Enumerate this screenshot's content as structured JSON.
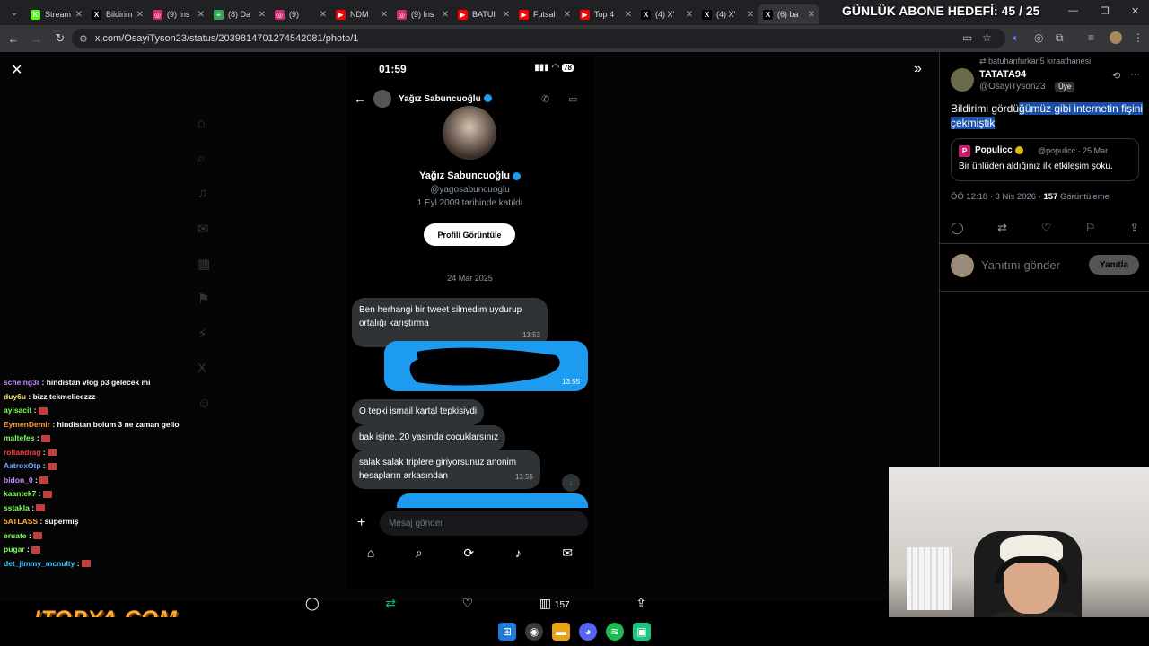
{
  "overlay_title": "GÜNLÜK ABONE HEDEFİ: 45 / 25",
  "browser": {
    "tabs": [
      {
        "label": "Stream",
        "icon": "kick-icon",
        "color": "#53fc18",
        "glyph": "K"
      },
      {
        "label": "Bildirim",
        "icon": "x-icon",
        "color": "#000000",
        "glyph": "X"
      },
      {
        "label": "(9) Ins",
        "icon": "instagram-icon",
        "color": "#d62976",
        "glyph": "◎"
      },
      {
        "label": "(8) Da",
        "icon": "chat-icon",
        "color": "#34a853",
        "glyph": "≡"
      },
      {
        "label": "(9)",
        "icon": "instagram-icon",
        "color": "#d62976",
        "glyph": "◎"
      },
      {
        "label": "NDM",
        "icon": "youtube-icon",
        "color": "#ff0000",
        "glyph": "▶"
      },
      {
        "label": "(9) Ins",
        "icon": "instagram-icon",
        "color": "#d62976",
        "glyph": "◎"
      },
      {
        "label": "BATUI",
        "icon": "youtube-icon",
        "color": "#ff0000",
        "glyph": "▶"
      },
      {
        "label": "Futsal",
        "icon": "youtube-icon",
        "color": "#ff0000",
        "glyph": "▶"
      },
      {
        "label": "Top 4",
        "icon": "youtube-icon",
        "color": "#ff0000",
        "glyph": "▶"
      },
      {
        "label": "(4) X'",
        "icon": "x-icon",
        "color": "#000000",
        "glyph": "X"
      },
      {
        "label": "(4) X'",
        "icon": "x-icon",
        "color": "#000000",
        "glyph": "X"
      },
      {
        "label": "(6) ba",
        "icon": "x-icon",
        "color": "#000000",
        "glyph": "X",
        "active": true
      }
    ],
    "url": "x.com/OsayiTyson23/status/2039814701274542081/photo/1"
  },
  "phone": {
    "time": "01:59",
    "battery": "78",
    "contact_name": "Yağız Sabuncuoğlu",
    "profile_name": "Yağız Sabuncuoğlu",
    "profile_handle": "@yagosabuncuoglu",
    "profile_joined": "1 Eyl 2009 tarihinde katıldı",
    "profile_button": "Profili Görüntüle",
    "date_separator": "24 Mar 2025",
    "messages": [
      {
        "text": "Ben herhangi bir tweet silmedim uydurup ortalığı karıştırma",
        "time": "13:53"
      },
      {
        "text": "O tepki ismail kartal tepkisiydi",
        "time": ""
      },
      {
        "text": "bak işine. 20 yasında cocuklarsınız",
        "time": ""
      },
      {
        "text": "salak salak triplere giriyorsunuz anonim hesapların arkasından",
        "time": "13:55"
      }
    ],
    "outgoing_time": "13:55",
    "compose_placeholder": "Mesaj gönder"
  },
  "bottom_bar": {
    "views": "157"
  },
  "chat": [
    {
      "user": "scheing3r",
      "color": "#c38cff",
      "text": "hindistan vlog p3 gelecek mi",
      "emote": false
    },
    {
      "user": "duy6u",
      "color": "#ffe066",
      "text": "bizz tekmelicezzz",
      "emote": false
    },
    {
      "user": "ayisacit",
      "color": "#7fff5a",
      "text": "",
      "emote": true
    },
    {
      "user": "EymenDemir",
      "color": "#ff9a3d",
      "text": "hindistan bolum 3 ne zaman gelio",
      "emote": false
    },
    {
      "user": "maltefes",
      "color": "#7fff5a",
      "text": "",
      "emote": true
    },
    {
      "user": "rollandrag",
      "color": "#ff3d3d",
      "text": "",
      "emote": true
    },
    {
      "user": "AatroxOtp",
      "color": "#6fa8ff",
      "text": "",
      "emote": true
    },
    {
      "user": "bidon_0",
      "color": "#c38cff",
      "text": "",
      "emote": true
    },
    {
      "user": "kaantek7",
      "color": "#7fff5a",
      "text": "",
      "emote": true
    },
    {
      "user": "sstakla",
      "color": "#7fff5a",
      "text": "",
      "emote": true
    },
    {
      "user": "5ATLASS",
      "color": "#ffb13d",
      "text": "süpermiş",
      "emote": false
    },
    {
      "user": "eruate",
      "color": "#7fff5a",
      "text": "",
      "emote": true
    },
    {
      "user": "pugar",
      "color": "#7fff5a",
      "text": "",
      "emote": true
    },
    {
      "user": "det_jimmy_mcnulty",
      "color": "#3dc6ff",
      "text": "",
      "emote": true
    }
  ],
  "logo_text": "ITOPYA.COM",
  "side": {
    "repost_line": "batuhanfurkan5 kıraathanesi",
    "name": "TATATA94",
    "handle": "@OsayiTyson23",
    "badge": "Üye",
    "tweet_plain": "Bildirimi gördü",
    "tweet_highlight": "ğümüz gibi internetin fişini çekmiştik",
    "quote_logo": "P",
    "quote_name": "Populicc",
    "quote_handle": "@populicc · 25 Mar",
    "quote_text": "Bir ünlüden aldığınız ilk etkileşim şoku.",
    "meta_time": "ÖÖ 12:18 · 3 Nis 2026 ·",
    "meta_views": "157",
    "meta_views_label": "Görüntüleme",
    "reply_placeholder": "Yanıtını gönder",
    "reply_button": "Yanıtla"
  }
}
